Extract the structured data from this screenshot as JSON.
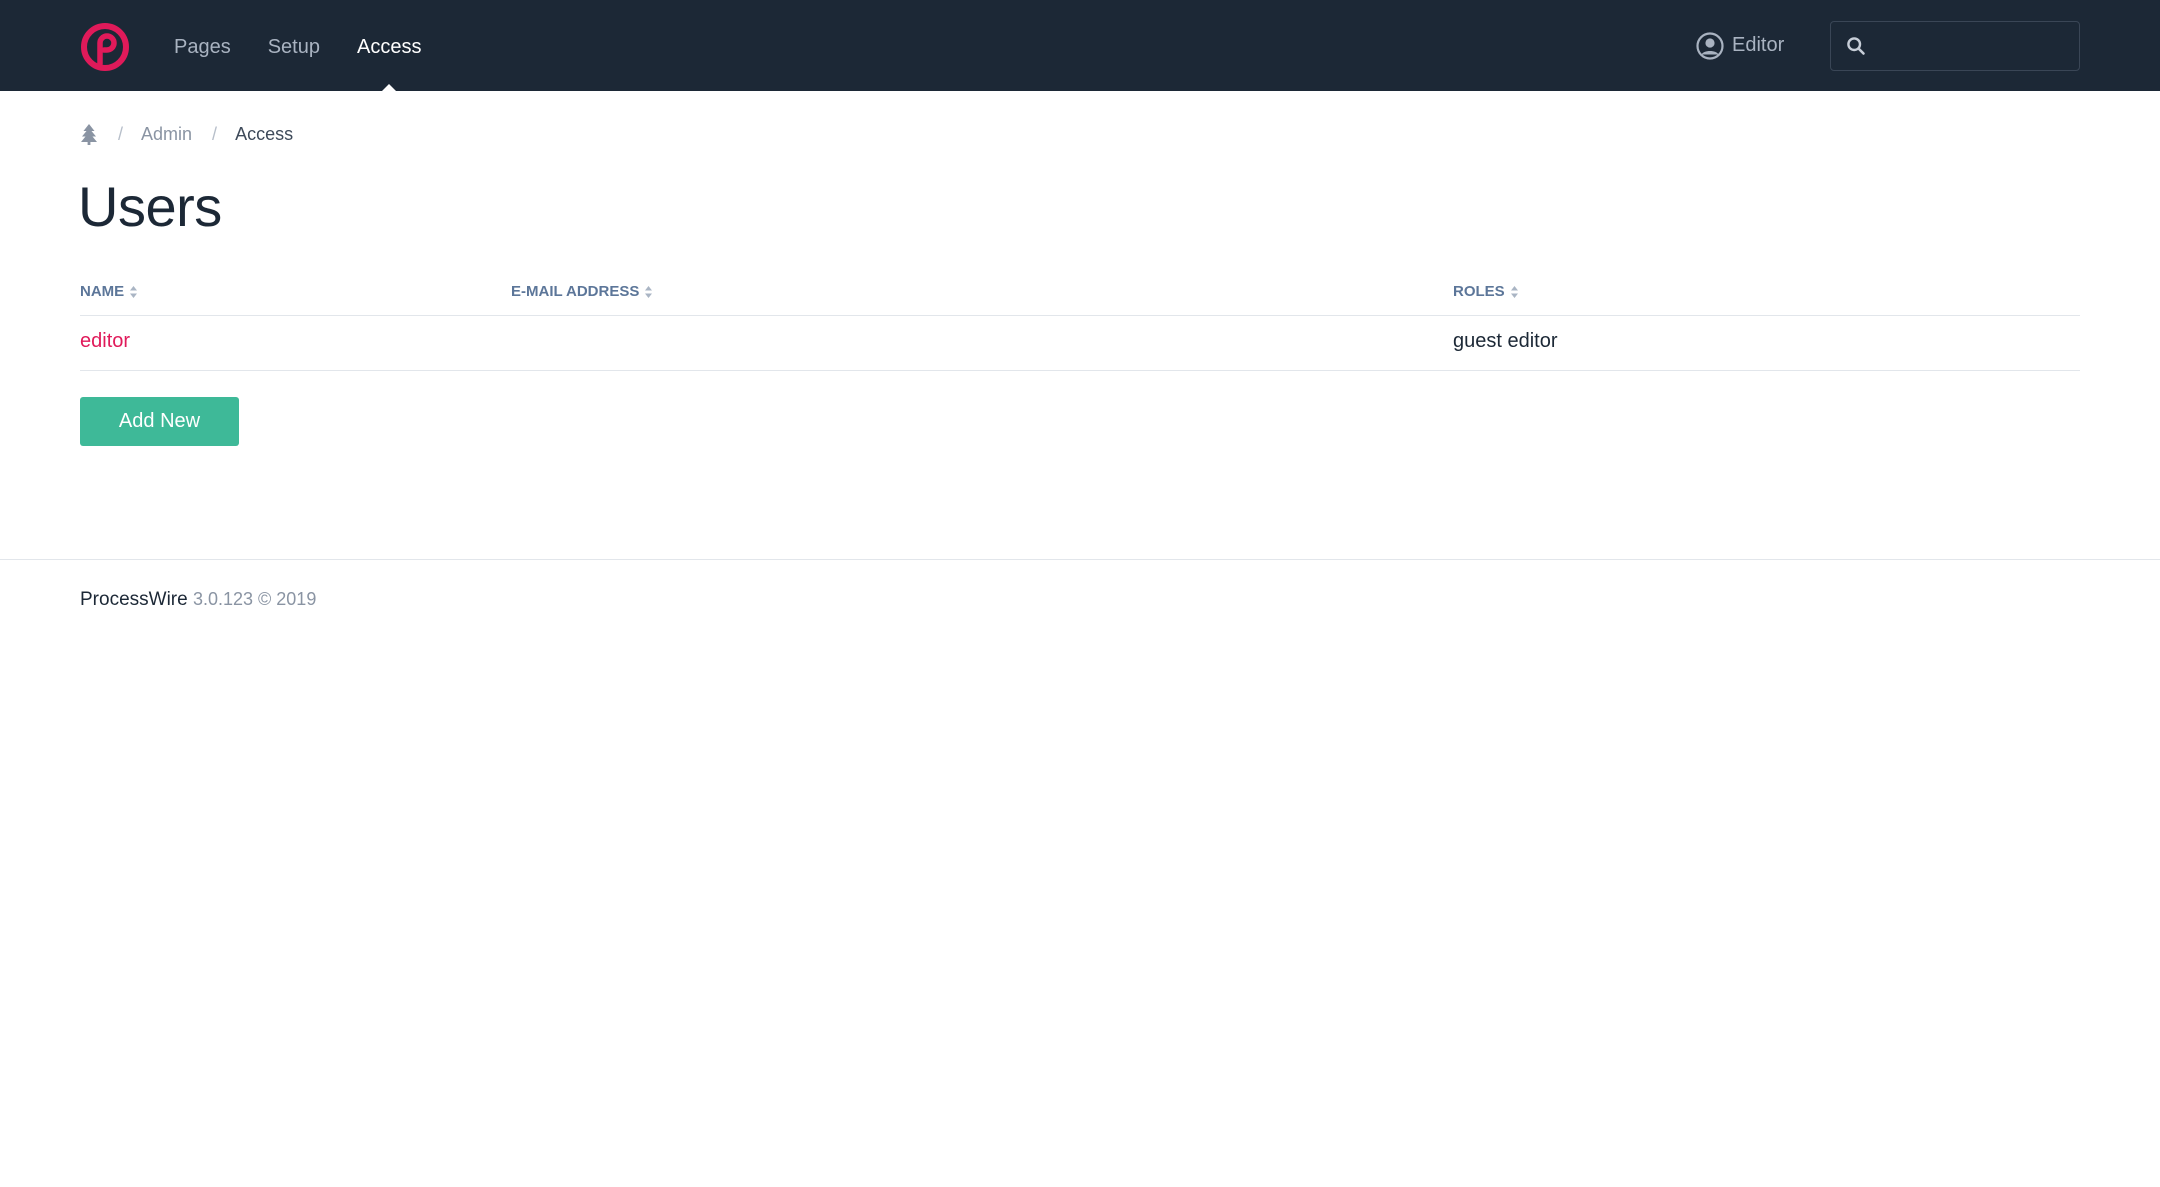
{
  "colors": {
    "topbar": "#1c2836",
    "brand_accent": "#e01a5a",
    "nav_inactive": "#a9b3c1",
    "nav_active": "#ffffff",
    "column_header": "#5c7699",
    "button_primary": "#3eb998",
    "border": "#e2e6eb"
  },
  "topnav": {
    "logo_icon": "processwire-logo-icon",
    "items": [
      {
        "label": "Pages",
        "active": false
      },
      {
        "label": "Setup",
        "active": false
      },
      {
        "label": "Access",
        "active": true
      }
    ],
    "user": {
      "icon": "user-circle-icon",
      "label": "Editor"
    },
    "search": {
      "icon": "search-icon",
      "placeholder": "",
      "value": ""
    }
  },
  "breadcrumb": {
    "home_icon": "tree-icon",
    "separator": "/",
    "items": [
      {
        "label": "Admin",
        "link": true
      },
      {
        "label": "Access",
        "link": false
      }
    ]
  },
  "page": {
    "title": "Users"
  },
  "table": {
    "sort_icon": "sort-icon",
    "columns": [
      "NAME",
      "E-MAIL ADDRESS",
      "ROLES"
    ],
    "rows": [
      {
        "name": "editor",
        "email": "",
        "roles": "guest editor"
      }
    ]
  },
  "actions": {
    "add_new_label": "Add New"
  },
  "footer": {
    "brand": "ProcessWire",
    "version": "3.0.123 © 2019"
  }
}
